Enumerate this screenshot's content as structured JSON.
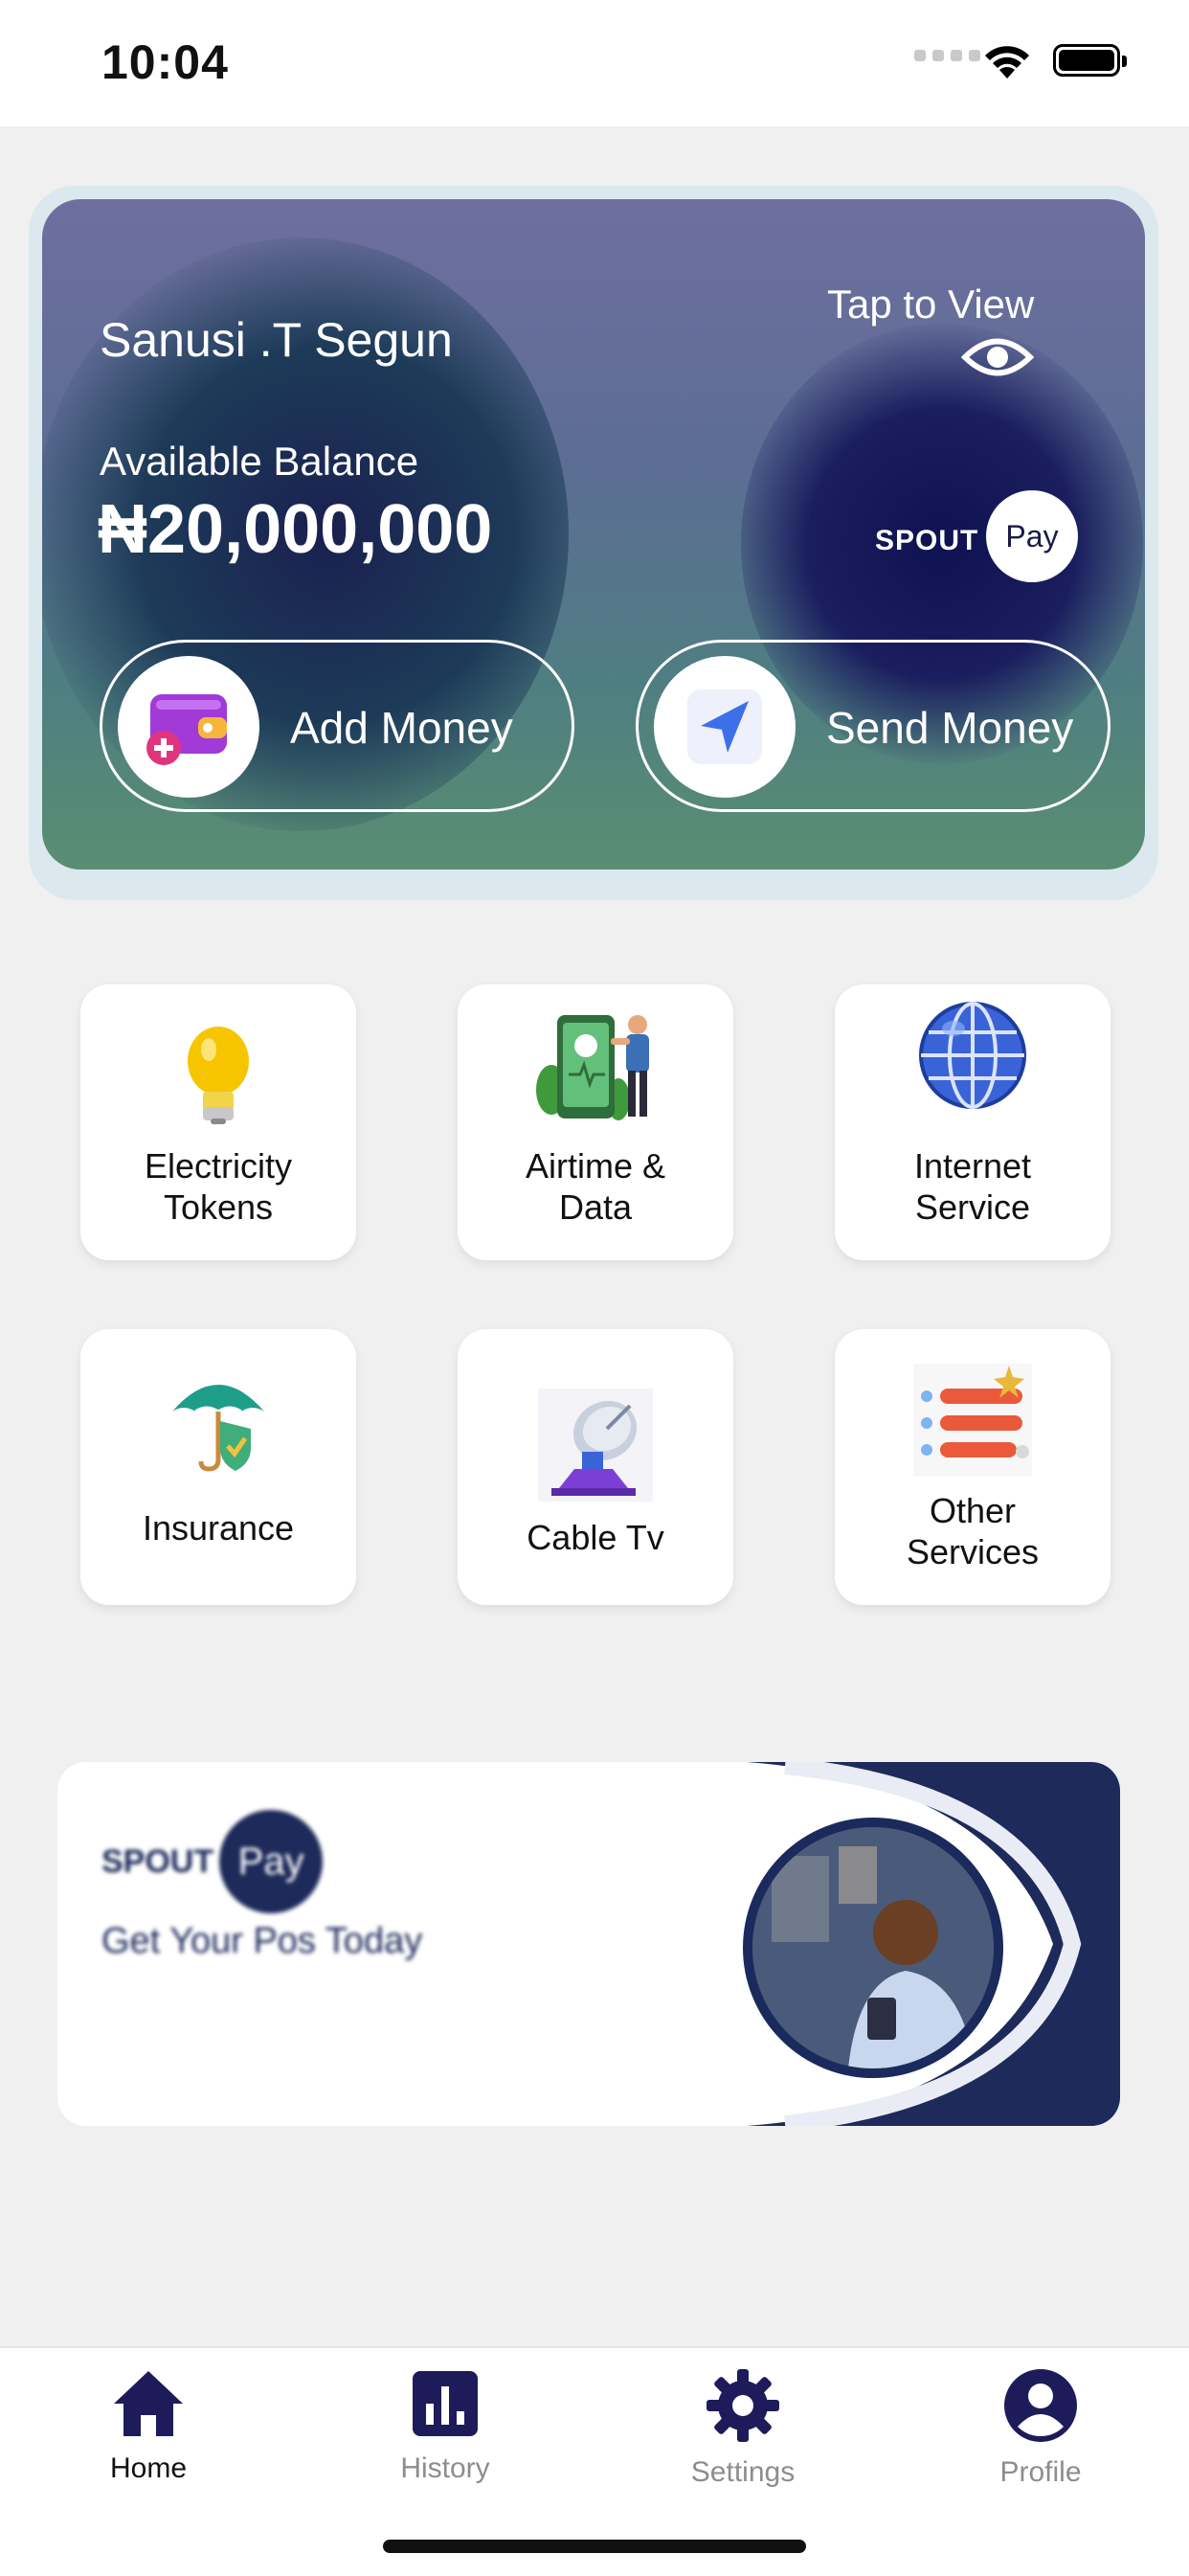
{
  "status_bar": {
    "time": "10:04"
  },
  "card": {
    "name": "Sanusi .T Segun",
    "tap_to_view": "Tap to View",
    "balance_label": "Available Balance",
    "balance": "₦20,000,000",
    "brand_word": "SPOUT",
    "brand_badge": "Pay",
    "add_money": "Add Money",
    "send_money": "Send Money"
  },
  "services": [
    {
      "label_line1": "Electricity",
      "label_line2": "Tokens",
      "icon": "lightbulb-icon"
    },
    {
      "label_line1": "Airtime &",
      "label_line2": "Data",
      "icon": "phone-airtime-icon"
    },
    {
      "label_line1": "Internet",
      "label_line2": "Service",
      "icon": "globe-icon"
    },
    {
      "label_line1": "Insurance",
      "label_line2": "",
      "icon": "umbrella-shield-icon"
    },
    {
      "label_line1": "Cable Tv",
      "label_line2": "",
      "icon": "satellite-dish-icon"
    },
    {
      "label_line1": "Other",
      "label_line2": "Services",
      "icon": "list-icon"
    }
  ],
  "banner": {
    "brand_word": "SPOUT",
    "brand_badge": "Pay",
    "tagline": "Get Your Pos Today"
  },
  "tabbar": {
    "home": "Home",
    "history": "History",
    "settings": "Settings",
    "profile": "Profile"
  },
  "colors": {
    "accent": "#1e1b5a",
    "inactive": "#8d8d8d",
    "banner_navy": "#1d2a5a"
  }
}
